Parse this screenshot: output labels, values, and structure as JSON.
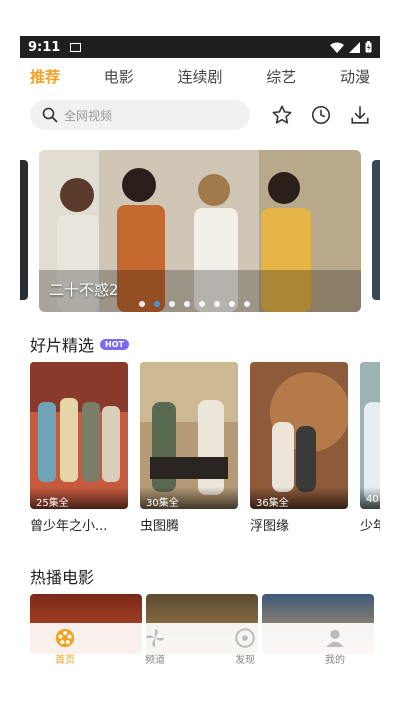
{
  "status": {
    "time": "9:11"
  },
  "tabs": [
    {
      "label": "推荐",
      "active": true
    },
    {
      "label": "电影",
      "active": false
    },
    {
      "label": "连续剧",
      "active": false
    },
    {
      "label": "综艺",
      "active": false
    },
    {
      "label": "动漫",
      "active": false
    }
  ],
  "search": {
    "placeholder": "全网视频"
  },
  "banner": {
    "title": "二十不惑2",
    "dot_count": 8,
    "active_dot": 1
  },
  "featured": {
    "title": "好片精选",
    "badge": "HOT",
    "items": [
      {
        "title": "曾少年之小...",
        "episodes": "25集全"
      },
      {
        "title": "虫图腾",
        "episodes": "30集全"
      },
      {
        "title": "浮图缘",
        "episodes": "36集全"
      },
      {
        "title": "少年",
        "episodes": "40"
      }
    ]
  },
  "movies": {
    "title": "热播电影"
  },
  "bottom_nav": [
    {
      "label": "首页",
      "active": true
    },
    {
      "label": "频道",
      "active": false
    },
    {
      "label": "发现",
      "active": false
    },
    {
      "label": "我的",
      "active": false
    }
  ],
  "colors": {
    "accent": "#f2a322",
    "hot_badge": "#7a6cf0",
    "dot_active": "#4a90d9"
  }
}
